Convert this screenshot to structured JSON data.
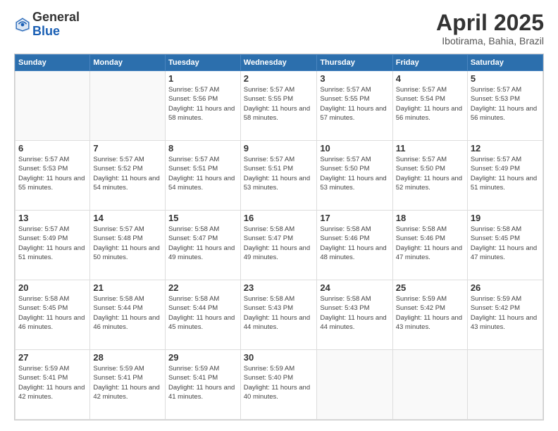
{
  "header": {
    "logo": {
      "general": "General",
      "blue": "Blue"
    },
    "title": "April 2025",
    "location": "Ibotirama, Bahia, Brazil"
  },
  "calendar": {
    "days_of_week": [
      "Sunday",
      "Monday",
      "Tuesday",
      "Wednesday",
      "Thursday",
      "Friday",
      "Saturday"
    ],
    "weeks": [
      [
        {
          "day": "",
          "info": ""
        },
        {
          "day": "",
          "info": ""
        },
        {
          "day": "1",
          "info": "Sunrise: 5:57 AM\nSunset: 5:56 PM\nDaylight: 11 hours and 58 minutes."
        },
        {
          "day": "2",
          "info": "Sunrise: 5:57 AM\nSunset: 5:55 PM\nDaylight: 11 hours and 58 minutes."
        },
        {
          "day": "3",
          "info": "Sunrise: 5:57 AM\nSunset: 5:55 PM\nDaylight: 11 hours and 57 minutes."
        },
        {
          "day": "4",
          "info": "Sunrise: 5:57 AM\nSunset: 5:54 PM\nDaylight: 11 hours and 56 minutes."
        },
        {
          "day": "5",
          "info": "Sunrise: 5:57 AM\nSunset: 5:53 PM\nDaylight: 11 hours and 56 minutes."
        }
      ],
      [
        {
          "day": "6",
          "info": "Sunrise: 5:57 AM\nSunset: 5:53 PM\nDaylight: 11 hours and 55 minutes."
        },
        {
          "day": "7",
          "info": "Sunrise: 5:57 AM\nSunset: 5:52 PM\nDaylight: 11 hours and 54 minutes."
        },
        {
          "day": "8",
          "info": "Sunrise: 5:57 AM\nSunset: 5:51 PM\nDaylight: 11 hours and 54 minutes."
        },
        {
          "day": "9",
          "info": "Sunrise: 5:57 AM\nSunset: 5:51 PM\nDaylight: 11 hours and 53 minutes."
        },
        {
          "day": "10",
          "info": "Sunrise: 5:57 AM\nSunset: 5:50 PM\nDaylight: 11 hours and 53 minutes."
        },
        {
          "day": "11",
          "info": "Sunrise: 5:57 AM\nSunset: 5:50 PM\nDaylight: 11 hours and 52 minutes."
        },
        {
          "day": "12",
          "info": "Sunrise: 5:57 AM\nSunset: 5:49 PM\nDaylight: 11 hours and 51 minutes."
        }
      ],
      [
        {
          "day": "13",
          "info": "Sunrise: 5:57 AM\nSunset: 5:49 PM\nDaylight: 11 hours and 51 minutes."
        },
        {
          "day": "14",
          "info": "Sunrise: 5:57 AM\nSunset: 5:48 PM\nDaylight: 11 hours and 50 minutes."
        },
        {
          "day": "15",
          "info": "Sunrise: 5:58 AM\nSunset: 5:47 PM\nDaylight: 11 hours and 49 minutes."
        },
        {
          "day": "16",
          "info": "Sunrise: 5:58 AM\nSunset: 5:47 PM\nDaylight: 11 hours and 49 minutes."
        },
        {
          "day": "17",
          "info": "Sunrise: 5:58 AM\nSunset: 5:46 PM\nDaylight: 11 hours and 48 minutes."
        },
        {
          "day": "18",
          "info": "Sunrise: 5:58 AM\nSunset: 5:46 PM\nDaylight: 11 hours and 47 minutes."
        },
        {
          "day": "19",
          "info": "Sunrise: 5:58 AM\nSunset: 5:45 PM\nDaylight: 11 hours and 47 minutes."
        }
      ],
      [
        {
          "day": "20",
          "info": "Sunrise: 5:58 AM\nSunset: 5:45 PM\nDaylight: 11 hours and 46 minutes."
        },
        {
          "day": "21",
          "info": "Sunrise: 5:58 AM\nSunset: 5:44 PM\nDaylight: 11 hours and 46 minutes."
        },
        {
          "day": "22",
          "info": "Sunrise: 5:58 AM\nSunset: 5:44 PM\nDaylight: 11 hours and 45 minutes."
        },
        {
          "day": "23",
          "info": "Sunrise: 5:58 AM\nSunset: 5:43 PM\nDaylight: 11 hours and 44 minutes."
        },
        {
          "day": "24",
          "info": "Sunrise: 5:58 AM\nSunset: 5:43 PM\nDaylight: 11 hours and 44 minutes."
        },
        {
          "day": "25",
          "info": "Sunrise: 5:59 AM\nSunset: 5:42 PM\nDaylight: 11 hours and 43 minutes."
        },
        {
          "day": "26",
          "info": "Sunrise: 5:59 AM\nSunset: 5:42 PM\nDaylight: 11 hours and 43 minutes."
        }
      ],
      [
        {
          "day": "27",
          "info": "Sunrise: 5:59 AM\nSunset: 5:41 PM\nDaylight: 11 hours and 42 minutes."
        },
        {
          "day": "28",
          "info": "Sunrise: 5:59 AM\nSunset: 5:41 PM\nDaylight: 11 hours and 42 minutes."
        },
        {
          "day": "29",
          "info": "Sunrise: 5:59 AM\nSunset: 5:41 PM\nDaylight: 11 hours and 41 minutes."
        },
        {
          "day": "30",
          "info": "Sunrise: 5:59 AM\nSunset: 5:40 PM\nDaylight: 11 hours and 40 minutes."
        },
        {
          "day": "",
          "info": ""
        },
        {
          "day": "",
          "info": ""
        },
        {
          "day": "",
          "info": ""
        }
      ]
    ]
  }
}
